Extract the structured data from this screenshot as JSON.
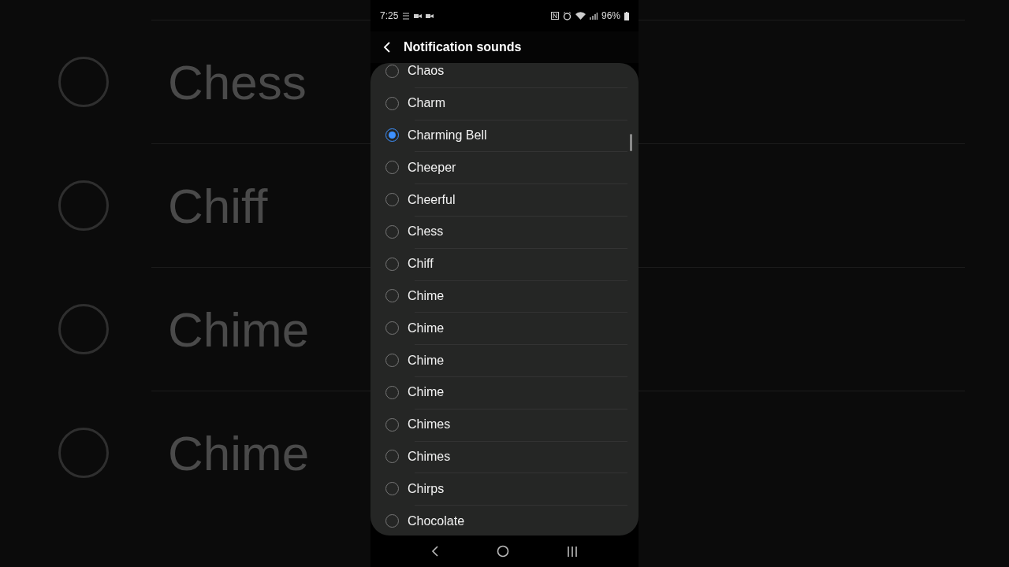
{
  "backdrop": [
    {
      "label": "Chess"
    },
    {
      "label": "Chiff"
    },
    {
      "label": "Chime"
    },
    {
      "label": "Chime"
    }
  ],
  "status_bar": {
    "time": "7:25",
    "battery": "96%"
  },
  "header": {
    "title": "Notification sounds"
  },
  "sounds": [
    {
      "label": "Chaos",
      "selected": false
    },
    {
      "label": "Charm",
      "selected": false
    },
    {
      "label": "Charming Bell",
      "selected": true
    },
    {
      "label": "Cheeper",
      "selected": false
    },
    {
      "label": "Cheerful",
      "selected": false
    },
    {
      "label": "Chess",
      "selected": false
    },
    {
      "label": "Chiff",
      "selected": false
    },
    {
      "label": "Chime",
      "selected": false
    },
    {
      "label": "Chime",
      "selected": false
    },
    {
      "label": "Chime",
      "selected": false
    },
    {
      "label": "Chime",
      "selected": false
    },
    {
      "label": "Chimes",
      "selected": false
    },
    {
      "label": "Chimes",
      "selected": false
    },
    {
      "label": "Chirps",
      "selected": false
    },
    {
      "label": "Chocolate",
      "selected": false
    }
  ]
}
